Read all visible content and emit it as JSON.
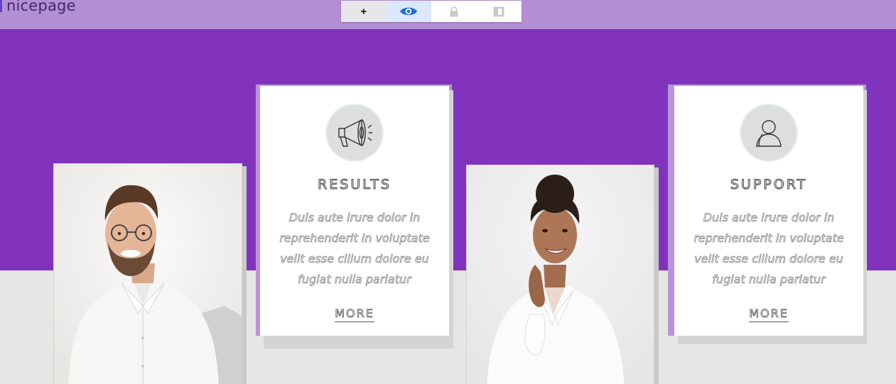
{
  "app": {
    "logo_text": "nicepage"
  },
  "toolbar": {
    "add_label": "+",
    "buttons": [
      {
        "icon": "plus-icon"
      },
      {
        "icon": "eye-icon"
      },
      {
        "icon": "lock-icon"
      },
      {
        "icon": "box-icon"
      }
    ]
  },
  "colors": {
    "topbar": "#b58fd6",
    "band": "#8133bd",
    "lower": "#e6e6e6",
    "accent_eye": "#1f6fd8"
  },
  "cards": [
    {
      "title": "RESULTS",
      "icon": "megaphone-icon",
      "text_lines": [
        "Duis aute irure dolor in",
        "reprehenderit in voluptate",
        "velit esse cillum dolore eu",
        "fugiat nulla pariatur"
      ],
      "more_label": "MORE"
    },
    {
      "title": "SUPPORT",
      "icon": "user-icon",
      "text_lines": [
        "Duis aute irure dolor in",
        "reprehenderit in voluptate",
        "velit esse cillum dolore eu",
        "fugiat nulla pariatur"
      ],
      "more_label": "MORE"
    }
  ],
  "photos": [
    {
      "subject": "smiling man with glasses in white shirt"
    },
    {
      "subject": "smiling woman in white shirt"
    }
  ]
}
